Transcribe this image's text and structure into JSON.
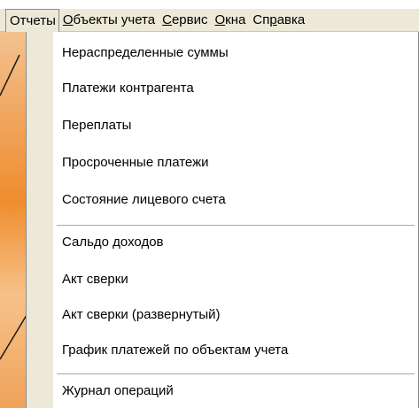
{
  "menubar": {
    "items": [
      {
        "label": "Отчеты",
        "active": true
      },
      {
        "label": "Объекты учета"
      },
      {
        "label": "Сервис"
      },
      {
        "label": "Окна"
      },
      {
        "label": "Справка"
      }
    ]
  },
  "dropdown": {
    "group1": [
      "Нераспределенные суммы",
      "Платежи контрагента",
      "Переплаты",
      "Просроченные платежи",
      "Состояние лицевого счета"
    ],
    "group2": [
      "Сальдо доходов",
      "Акт сверки",
      "Акт сверки (развернутый)",
      "График платежей по объектам учета"
    ],
    "group3": [
      "Журнал операций"
    ]
  },
  "colors": {
    "menu_bg": "#ece9d8",
    "accent_orange": "#ef8d2f",
    "border": "#8a8a8a"
  }
}
